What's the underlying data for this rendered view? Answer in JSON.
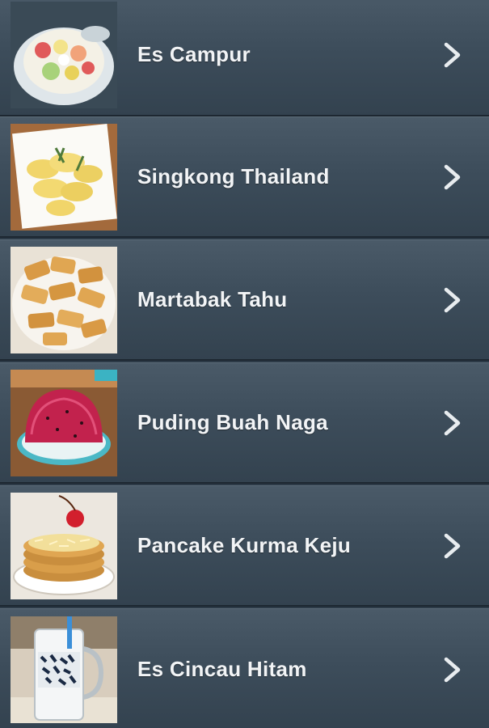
{
  "recipes": [
    {
      "label": "Es Campur",
      "thumbnail": "es-campur-image",
      "icon": "chevron-right-icon"
    },
    {
      "label": "Singkong Thailand",
      "thumbnail": "singkong-thailand-image",
      "icon": "chevron-right-icon"
    },
    {
      "label": "Martabak Tahu",
      "thumbnail": "martabak-tahu-image",
      "icon": "chevron-right-icon"
    },
    {
      "label": "Puding Buah Naga",
      "thumbnail": "puding-buah-naga-image",
      "icon": "chevron-right-icon"
    },
    {
      "label": "Pancake Kurma Keju",
      "thumbnail": "pancake-kurma-keju-image",
      "icon": "chevron-right-icon"
    },
    {
      "label": "Es Cincau Hitam",
      "thumbnail": "es-cincau-hitam-image",
      "icon": "chevron-right-icon"
    }
  ],
  "colors": {
    "row_top": "#4a5a68",
    "row_bottom": "#33424f",
    "label_text": "#f2f4f6",
    "chevron": "#e8ecef"
  }
}
